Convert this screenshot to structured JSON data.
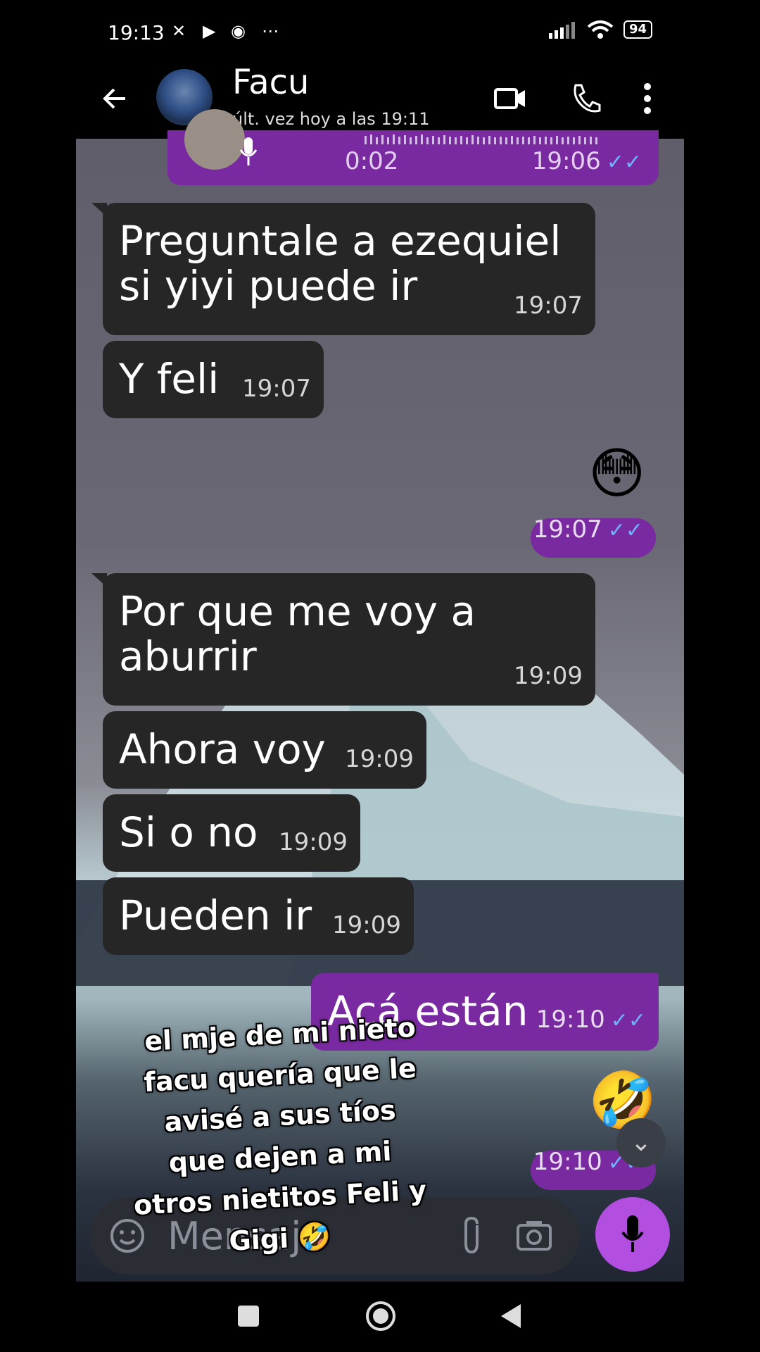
{
  "status_bar": {
    "time": "19:13",
    "battery": "94"
  },
  "contact": {
    "name": "Facu",
    "last_seen": "últ. vez hoy a las 19:11"
  },
  "voice_message": {
    "duration": "0:02",
    "time": "19:06"
  },
  "messages": [
    {
      "dir": "in",
      "text": "Preguntale a ezequiel\nsi yiyi puede ir",
      "time": "19:07"
    },
    {
      "dir": "in",
      "text": "Y feli",
      "time": "19:07"
    },
    {
      "dir": "out",
      "emoji": "😳",
      "time": "19:07"
    },
    {
      "dir": "in",
      "text": "Por que me voy a\naburrir",
      "time": "19:09"
    },
    {
      "dir": "in",
      "text": "Ahora voy",
      "time": "19:09"
    },
    {
      "dir": "in",
      "text": "Si o no",
      "time": "19:09"
    },
    {
      "dir": "in",
      "text": "Pueden ir",
      "time": "19:09"
    },
    {
      "dir": "out",
      "text": "Acá están",
      "time": "19:10"
    },
    {
      "dir": "out",
      "emoji": "🤣",
      "time": "19:10"
    }
  ],
  "input": {
    "placeholder": "Mensaje"
  },
  "overlay_caption": [
    "el mje de mi nieto",
    "facu quería que le",
    "avisé a sus tíos",
    "que dejen a mi",
    "otros nietitos Feli y",
    "Gigi 🤣"
  ],
  "colors": {
    "outgoing": "#7a2aa0",
    "incoming": "#262626",
    "mic": "#b24ee0",
    "read_ticks": "#6fb0ff"
  },
  "icons": [
    "back-arrow-icon",
    "video-call-icon",
    "phone-icon",
    "more-vert-icon",
    "mic-icon",
    "emoji-icon",
    "attach-icon",
    "camera-icon",
    "scroll-down-icon",
    "nav-square-icon",
    "nav-home-icon",
    "nav-back-icon"
  ]
}
